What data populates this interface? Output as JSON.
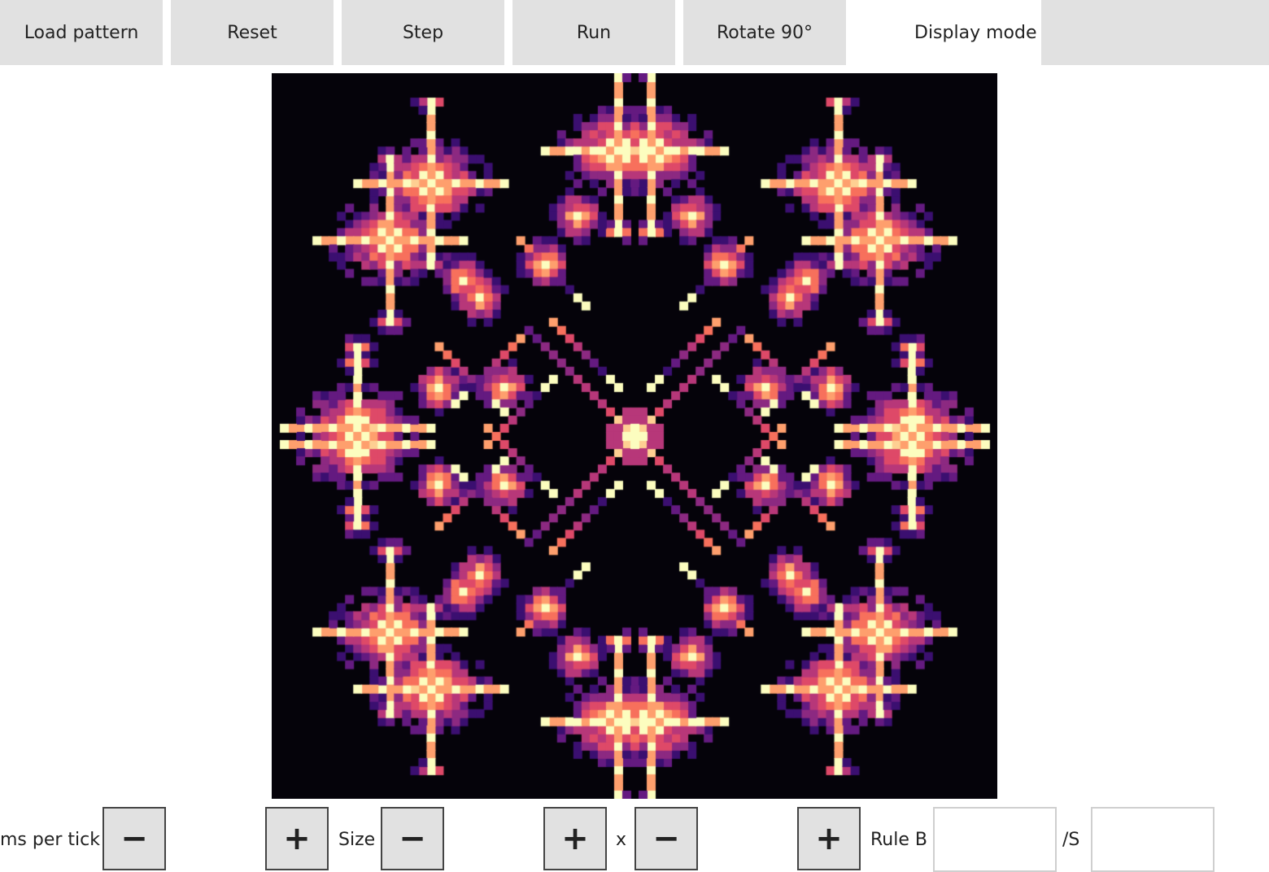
{
  "toolbar": {
    "load": "Load pattern",
    "reset": "Reset",
    "step": "Step",
    "run": "Run",
    "rotate": "Rotate 90°",
    "display_mode": "Display mode"
  },
  "controls": {
    "ms_label": "ms per tick",
    "size_label": "Size",
    "x_label": "x",
    "rule_b_label": "Rule B",
    "rule_s_label": "/S",
    "minus": "−",
    "plus": "+",
    "ms_value": "",
    "width_value": "",
    "height_value": "",
    "rule_b_value": "",
    "rule_s_value": ""
  },
  "board": {
    "background": "#05030a",
    "palette": [
      "#3b0f70",
      "#641a80",
      "#8c2981",
      "#b73779",
      "#de4968",
      "#f7705c",
      "#fe9f6d",
      "#fecf92",
      "#fcfdbf"
    ]
  }
}
